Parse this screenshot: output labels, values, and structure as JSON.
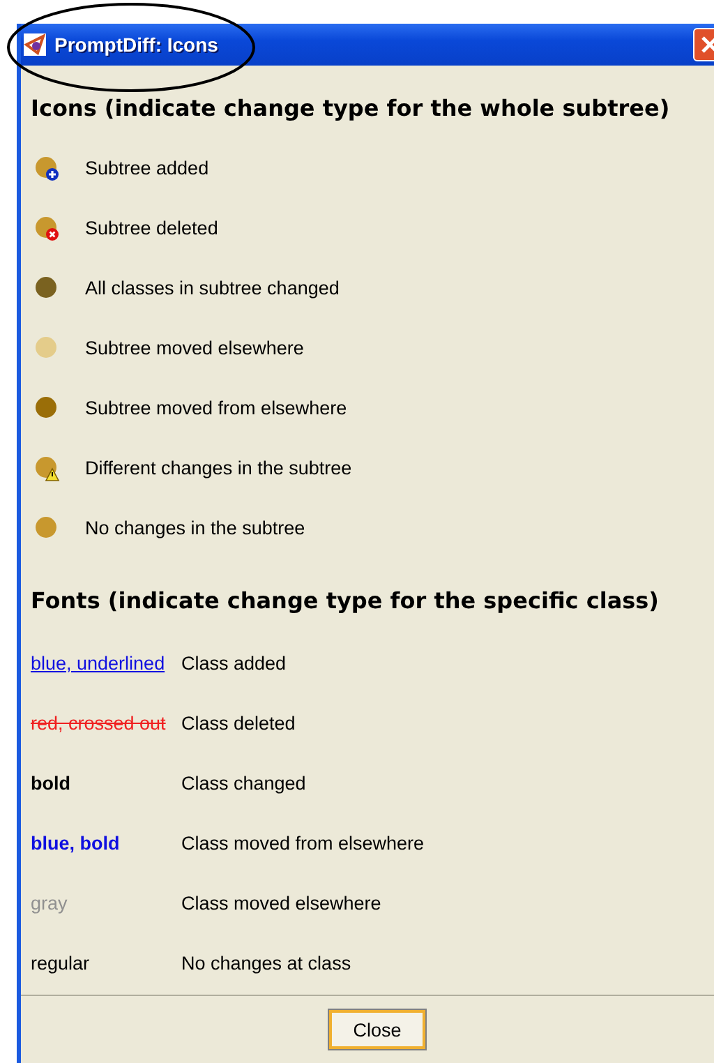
{
  "window": {
    "title": "PromptDiff: Icons"
  },
  "icons_section": {
    "heading": "Icons (indicate change type for the whole subtree)",
    "items": [
      {
        "kind": "added",
        "color": "#c8982e",
        "label": "Subtree added"
      },
      {
        "kind": "deleted",
        "color": "#c8982e",
        "label": "Subtree deleted"
      },
      {
        "kind": "plain",
        "color": "#7a6220",
        "label": "All classes in subtree changed"
      },
      {
        "kind": "plain",
        "color": "#e4cc8a",
        "label": "Subtree moved elsewhere"
      },
      {
        "kind": "plain",
        "color": "#9a6e08",
        "label": "Subtree moved from elsewhere"
      },
      {
        "kind": "warning",
        "color": "#c8982e",
        "label": "Different changes in the subtree"
      },
      {
        "kind": "plain",
        "color": "#c8982e",
        "label": "No changes in the subtree"
      }
    ]
  },
  "fonts_section": {
    "heading": "Fonts (indicate change type for the specific class)",
    "items": [
      {
        "kind": "underlined",
        "sample": "blue, underlined",
        "label": "Class added"
      },
      {
        "kind": "crossed",
        "sample": "red, crossed out",
        "label": "Class deleted"
      },
      {
        "kind": "bold",
        "sample": "bold",
        "label": "Class changed"
      },
      {
        "kind": "bluebold",
        "sample": "blue, bold",
        "label": "Class moved from elsewhere"
      },
      {
        "kind": "gray",
        "sample": "gray",
        "label": "Class moved elsewhere"
      },
      {
        "kind": "regular",
        "sample": "regular",
        "label": "No changes at class"
      }
    ]
  },
  "buttons": [
    "Close"
  ]
}
